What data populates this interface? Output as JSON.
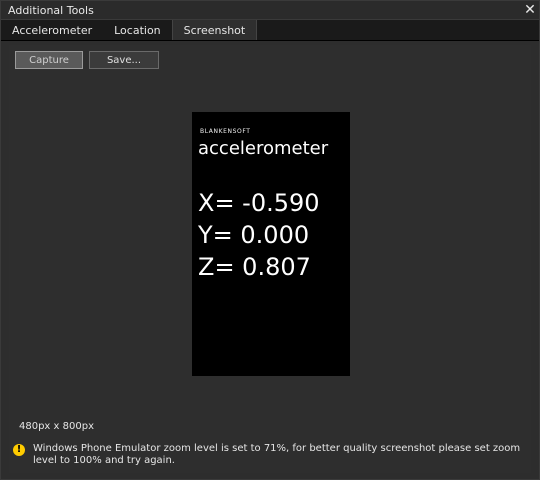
{
  "window": {
    "title": "Additional Tools",
    "close_glyph": "✕"
  },
  "tabs": [
    {
      "label": "Accelerometer"
    },
    {
      "label": "Location"
    },
    {
      "label": "Screenshot"
    }
  ],
  "toolbar": {
    "capture_label": "Capture",
    "save_label": "Save..."
  },
  "phone": {
    "brand": "BLANKENSOFT",
    "app_title": "accelerometer",
    "readings": {
      "x": "X= -0.590",
      "y": "Y= 0.000",
      "z": "Z= 0.807"
    }
  },
  "footer": {
    "dimensions": "480px x 800px",
    "warning_icon": "!",
    "warning_text": "Windows Phone Emulator zoom level is set to 71%, for better quality screenshot please set zoom level to 100% and try again."
  },
  "colors": {
    "background": "#2e2e2e",
    "titlebar": "#2b2b2b",
    "tabbar": "#1a1a1a",
    "phone_screen": "#000000",
    "warning": "#ffcc00"
  }
}
